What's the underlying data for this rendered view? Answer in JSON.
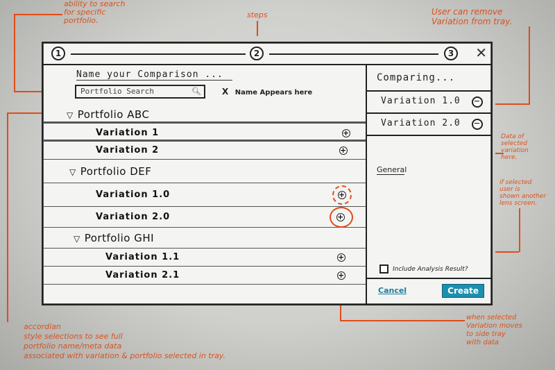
{
  "notes": {
    "search": "ability to search\nfor specific\nportfolio.",
    "steps": "steps",
    "remove": "User can remove\nVariation from tray.",
    "data_of_selected": "Data of\nselected\nvariation\nhere.",
    "if_selected": "if selected\nuser is\nshown another\nlens screen.",
    "accordian": "accordian\nstyle selections to see full\nportfolio name/meta data\nassociated with variation & portfolio selected in tray.",
    "when_selected": "when selected\nVariation moves\nto side tray\nwith data"
  },
  "stepper": {
    "steps": [
      "1",
      "2",
      "3"
    ],
    "close": "✕"
  },
  "left": {
    "name_placeholder": "Name your Comparison ...",
    "search_placeholder": "Portfolio Search",
    "name_appears": "Name Appears here",
    "name_appears_x": "X"
  },
  "tree": {
    "portfolios": [
      {
        "name": "Portfolio ABC",
        "variations": [
          "Variation 1",
          "Variation 2"
        ]
      },
      {
        "name": "Portfolio DEF",
        "variations": [
          "Variation 1.0",
          "Variation 2.0"
        ]
      },
      {
        "name": "Portfolio GHI",
        "variations": [
          "Variation 1.1",
          "Variation 2.1"
        ]
      }
    ]
  },
  "tray": {
    "title": "Comparing...",
    "items": [
      "Variation 1.0",
      "Variation 2.0"
    ],
    "general": "General",
    "checkbox_label": "Include Analysis Result?",
    "cancel": "Cancel",
    "create": "Create"
  },
  "colors": {
    "annotation": "#e04c16",
    "accent": "#1b8fb0"
  }
}
